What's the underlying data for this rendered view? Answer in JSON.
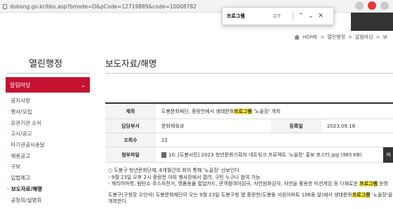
{
  "browser": {
    "url": "dobong.go.kr/bbs.asp?bmode=D&pCode=12719889&code=10008782"
  },
  "find": {
    "query": "프로그램",
    "count": "2/7",
    "up_icon": "chevron-up-icon",
    "down_icon": "chevron-down-icon",
    "close_icon": "close-icon"
  },
  "breadcrumb": {
    "items": [
      "HOME",
      ">",
      "열린행정",
      ">",
      "알림마당",
      ">",
      "보"
    ]
  },
  "sidebar": {
    "title": "열린행정",
    "active": "알림마당",
    "items": [
      "공지사항",
      "행사/모집",
      "유관기관 소식",
      "고시/공고",
      "타기관공시송달",
      "채용공고",
      "구보",
      "입법예고",
      "보도자료/해명",
      "공청회/설명회"
    ]
  },
  "main": {
    "title": "보도자료/해명"
  },
  "table": {
    "subject_label": "제목",
    "subject_pre": "도봉문화재단, 중랑천에서 생태문화",
    "subject_hl": "프로그램",
    "subject_post": " '노을장' 개최",
    "dept_label": "담당부서",
    "dept_value": "문화체육과",
    "date_label": "등록일",
    "date_value": "2023.09.18",
    "views_label": "조회수",
    "views_value": "22",
    "file_label": "첨부파일",
    "file_value": "10. [도봉사진] 2023 청년문화기획자 네트워크 프로젝트 '노을장' 홍보 포스터.jpg (985 KB)"
  },
  "body": {
    "line1": "○ 도봉구 청년문화단체, 6개월간의 회의 통해 '노을장' 선보인다",
    "line2": " - 9월 23일 오후 2시 중랑천 야외 행사장에서 열려, 구민 누구나 참여 가능",
    "line3_pre": " - 캐리어마켓, 탐탄소 주스자전거, 명품동물 팝업카드, 관객참여아임극, 자연원화감각, 자연을 활용한 미션게임 등 다채로운 ",
    "line3_hl": "프로그램",
    "line3_post": " 운영",
    "line4_pre": "도봉구(구청장 오언석) 도봉문화재단이 오는 9월 23일 도봉구청 옆 중랑천(도봉동 서원아파트 106동 앞)에서 생태문화",
    "line4_hl": "프로그램",
    "line4_post": " '노을장'을",
    "line5": "개최한다."
  },
  "float_button": "마"
}
